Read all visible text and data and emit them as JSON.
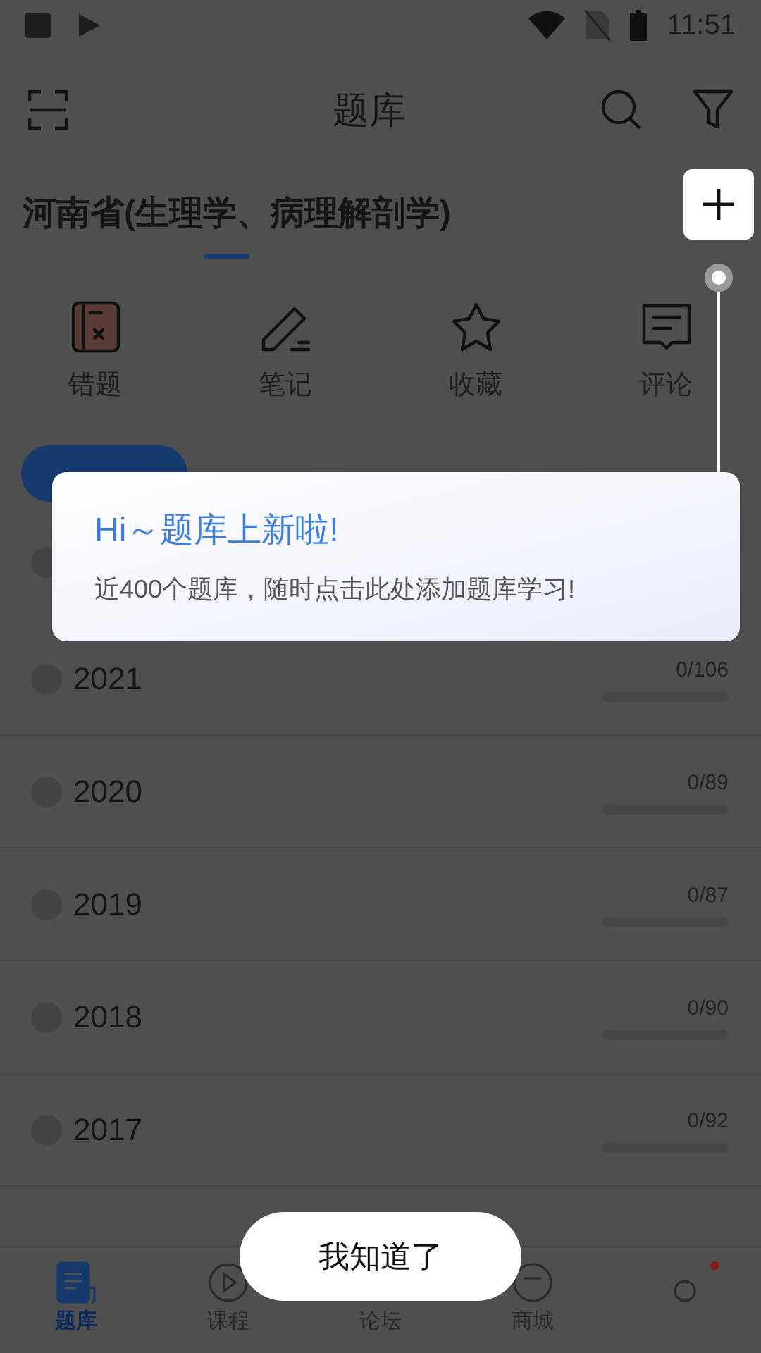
{
  "status_bar": {
    "time": "11:51"
  },
  "header": {
    "title": "题库"
  },
  "subject": {
    "title": "河南省(生理学、病理解剖学)"
  },
  "shortcuts": [
    {
      "kind": "wrong",
      "label": "错题"
    },
    {
      "kind": "note",
      "label": "笔记"
    },
    {
      "kind": "star",
      "label": "收藏"
    },
    {
      "kind": "comment",
      "label": "评论"
    }
  ],
  "rows": [
    {
      "year": "2021",
      "progress": "0/106",
      "level": 0
    },
    {
      "year": "2020",
      "progress": "0/89",
      "level": 0
    },
    {
      "year": "2019",
      "progress": "0/87",
      "level": 0
    },
    {
      "year": "2018",
      "progress": "0/90",
      "level": 0
    },
    {
      "year": "2017",
      "progress": "0/92",
      "level": 0
    }
  ],
  "tooltip": {
    "title": "Hi～题库上新啦!",
    "text": "近400个题库，随时点击此处添加题库学习!"
  },
  "dismiss_button": "我知道了",
  "bottom_nav": [
    {
      "kind": "bank",
      "label": "题库",
      "selected": true
    },
    {
      "kind": "course",
      "label": "课程",
      "selected": false
    },
    {
      "kind": "forum",
      "label": "论坛",
      "selected": false
    },
    {
      "kind": "shop",
      "label": "商城",
      "selected": false
    },
    {
      "kind": "me",
      "selected": false
    }
  ]
}
